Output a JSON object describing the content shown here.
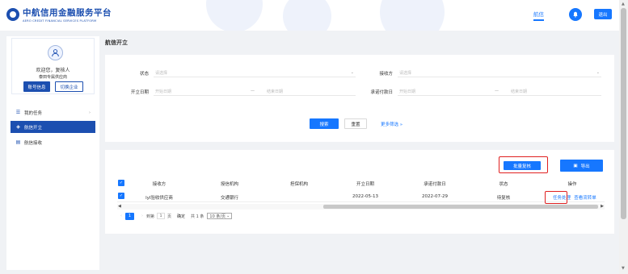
{
  "header": {
    "logo_cn": "中航信用金融服务平台",
    "logo_en": "AERO CREDIT FINANCIAL SERVICES PLATFORM",
    "nav_tab": "航信",
    "logout": "退出"
  },
  "sidebar": {
    "welcome": "欢迎您，复核人",
    "company": "泰田专属供应商",
    "account_btn": "账号信息",
    "switch_btn": "切换企业",
    "items": [
      {
        "label": "我的任务",
        "icon": "task-icon"
      },
      {
        "label": "航信开立",
        "icon": "layers-icon"
      },
      {
        "label": "航信接收",
        "icon": "receive-icon"
      }
    ]
  },
  "main": {
    "title": "航信开立",
    "filters": {
      "status_label": "状态",
      "status_placeholder": "请选择",
      "receiver_label": "接收方",
      "receiver_placeholder": "请选择",
      "open_date_label": "开立日期",
      "open_start": "开始日期",
      "open_end": "结束日期",
      "pay_date_label": "承诺付款日",
      "pay_start": "开始日期",
      "pay_end": "结束日期",
      "range_sep": "—",
      "search_btn": "搜索",
      "reset_btn": "重置",
      "more_filter": "更多筛选"
    },
    "table": {
      "batch_review_btn": "批量复核",
      "export_btn": "导出",
      "columns": [
        "接收方",
        "授信机构",
        "担保机构",
        "开立日期",
        "承诺付款日",
        "状态",
        "操作"
      ],
      "rows": [
        {
          "receiver": "lyl验收供应商",
          "credit_org": "交通银行",
          "guarantee_org": "",
          "open_date": "2022-05-13",
          "pay_date": "2022-07-29",
          "status": "待复核",
          "op_task": "任务处理",
          "op_flow": "查看流转单"
        }
      ]
    },
    "pager": {
      "page": "1",
      "goto": "到第",
      "page_input": "1",
      "page_unit": "页",
      "confirm": "确定",
      "total": "共 1 条",
      "page_size": "10 条/页"
    }
  },
  "colors": {
    "brand": "#1c4fb0",
    "primary": "#1677ff",
    "highlight": "#e02020"
  }
}
